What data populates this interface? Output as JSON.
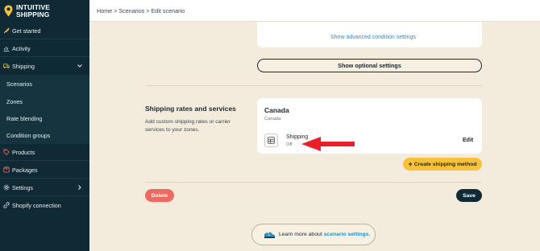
{
  "brand": {
    "line1": "INTUITIVE",
    "line2": "SHIPPING",
    "accent": "#f7c13a"
  },
  "sidebar": {
    "items": [
      {
        "label": "Get started",
        "icon": "rocket-icon"
      },
      {
        "label": "Activity",
        "icon": "activity-chart-icon"
      },
      {
        "label": "Shipping",
        "icon": "truck-icon",
        "expanded": true
      },
      {
        "label": "Scenarios"
      },
      {
        "label": "Zones"
      },
      {
        "label": "Rate blending"
      },
      {
        "label": "Condition groups"
      },
      {
        "label": "Products",
        "icon": "tag-icon"
      },
      {
        "label": "Packages",
        "icon": "package-icon"
      },
      {
        "label": "Settings",
        "icon": "gear-icon"
      },
      {
        "label": "Shopify connection",
        "icon": "link-icon"
      }
    ]
  },
  "header": {
    "breadcrumb": "Home > Scenarios > Edit scenario"
  },
  "conditions": {
    "advanced_link": "Show advanced condition settings",
    "optional_button": "Show optional settings"
  },
  "rates": {
    "title": "Shipping rates and services",
    "description": "Add custom shipping rates or carrier services to your zones.",
    "zone": {
      "name": "Canada",
      "sub": "Canada",
      "method": {
        "name": "Shipping",
        "status": "Off",
        "edit": "Edit",
        "icon": "table-icon"
      }
    },
    "create_button": "Create shipping method"
  },
  "actions": {
    "delete": "Delete",
    "save": "Save"
  },
  "learn": {
    "prefix": "Learn more about",
    "link": "scenario settings",
    "suffix": "."
  }
}
